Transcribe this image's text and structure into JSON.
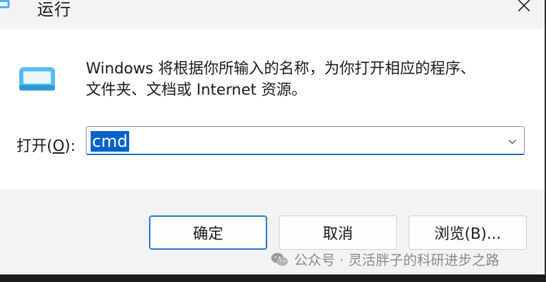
{
  "window": {
    "title": "运行",
    "close_icon": "close-icon"
  },
  "content": {
    "description_line1": "Windows 将根据你所输入的名称，为你打开相应的程序、",
    "description_line2": "文件夹、文档或 Internet 资源。",
    "open_label_prefix": "打开(",
    "open_label_key": "O",
    "open_label_suffix": "):",
    "input_value": "cmd",
    "dropdown_icon": "chevron-down-icon"
  },
  "buttons": {
    "ok": "确定",
    "cancel": "取消",
    "browse": "浏览(B)..."
  },
  "watermark": {
    "text": "公众号 · 灵活胖子的科研进步之路",
    "icon": "wechat-icon"
  },
  "colors": {
    "accent": "#0063c9",
    "focus_border": "#1f73c8"
  }
}
